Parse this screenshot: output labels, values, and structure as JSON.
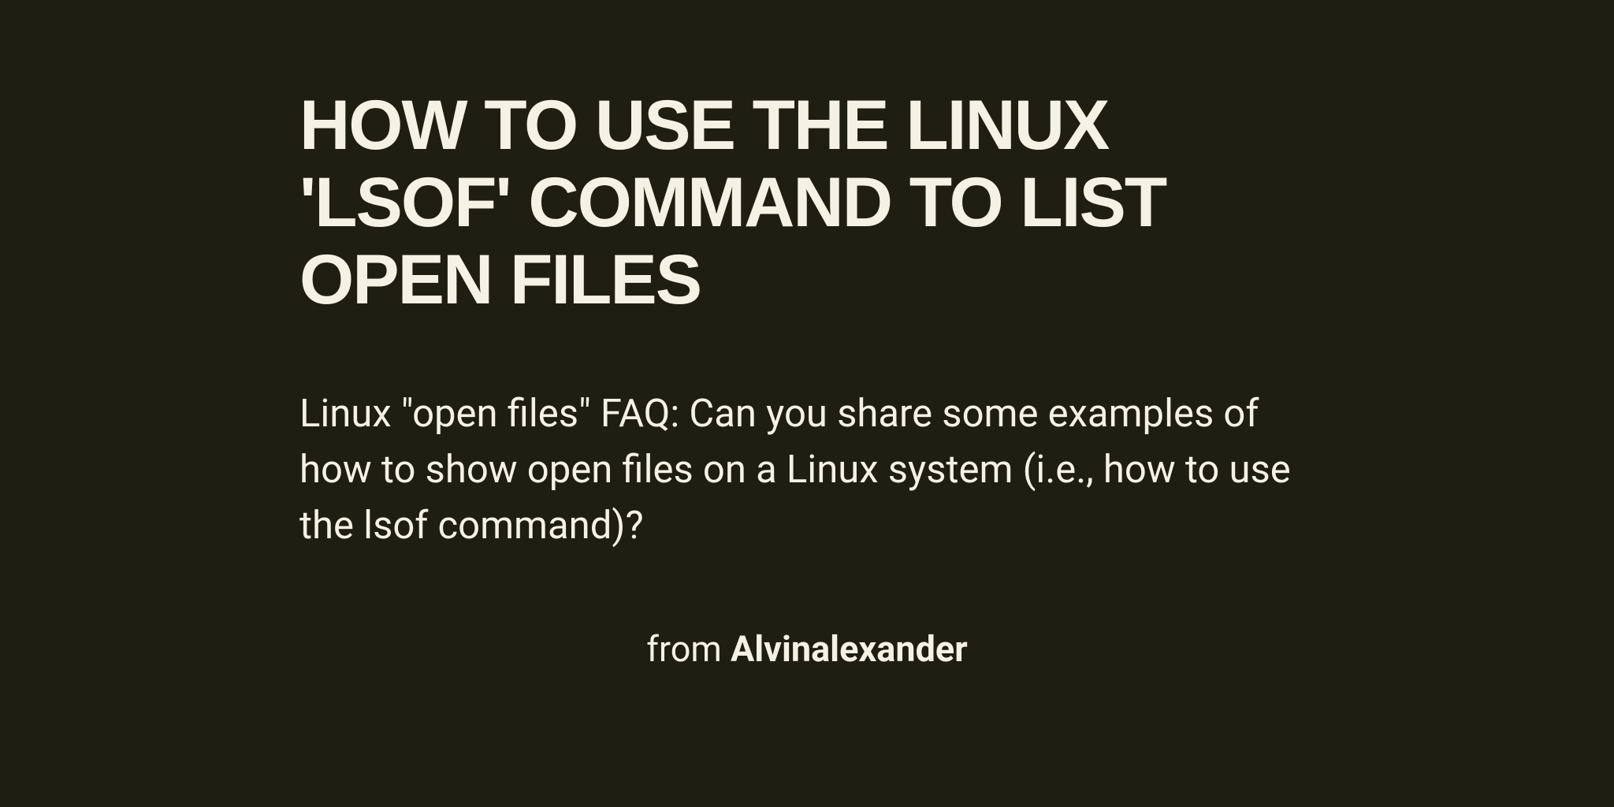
{
  "article": {
    "title": "HOW TO USE THE LINUX 'LSOF' COMMAND TO LIST OPEN FILES",
    "summary": "Linux \"open files\" FAQ: Can you share some examples of how to show open files on a Linux system (i.e., how to use the lsof command)?"
  },
  "attribution": {
    "prefix": "from ",
    "author": "Alvinalexander"
  }
}
